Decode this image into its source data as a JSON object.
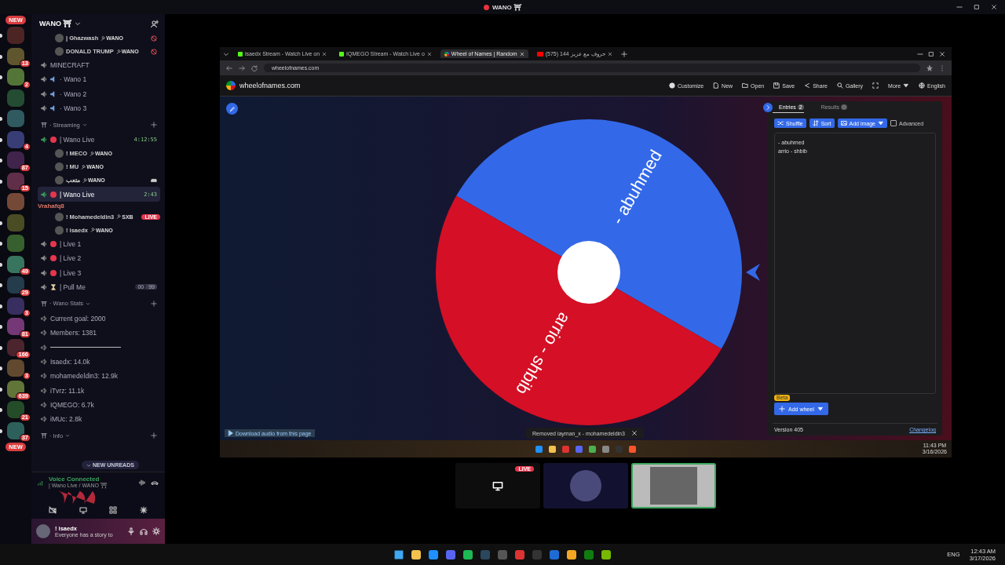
{
  "titlebar": {
    "title": "WANO ⛩"
  },
  "servers": {
    "new_top": "NEW",
    "new_bottom": "NEW",
    "items": [
      {
        "unread": true
      },
      {
        "unread": true,
        "badge": "13"
      },
      {
        "unread": true,
        "badge": "2"
      },
      {
        "unread": false
      },
      {
        "unread": true
      },
      {
        "unread": true,
        "badge": "4"
      },
      {
        "unread": true,
        "badge": "87"
      },
      {
        "unread": true,
        "badge": "15"
      },
      {
        "unread": false
      },
      {
        "unread": true
      },
      {
        "unread": true
      },
      {
        "unread": true,
        "badge": "49"
      },
      {
        "unread": true,
        "badge": "29"
      },
      {
        "unread": true,
        "badge": "3"
      },
      {
        "unread": true,
        "badge": "81"
      },
      {
        "unread": true,
        "badge": "166"
      },
      {
        "unread": true,
        "badge": "3"
      },
      {
        "unread": true,
        "badge": "639"
      },
      {
        "unread": true,
        "badge": "21"
      },
      {
        "unread": true,
        "badge": "37"
      }
    ]
  },
  "sidebar": {
    "server_name": "WANO ⛩",
    "items": [
      {
        "kind": "member",
        "name": "| Ghazwash",
        "tag": "WANO",
        "muted": true,
        "playing": false
      },
      {
        "kind": "member",
        "name": "DONALD TRUMP",
        "tag": "WANO",
        "muted": true,
        "playing": false
      },
      {
        "kind": "plain",
        "name": "MINECRAFT",
        "connected": false,
        "selected": false
      },
      {
        "kind": "audio",
        "name": "· Wano 1",
        "connected": false,
        "selected": false
      },
      {
        "kind": "audio",
        "name": "· Wano 2",
        "connected": false,
        "selected": false
      },
      {
        "kind": "audio",
        "name": "· Wano 3",
        "connected": false,
        "selected": false
      },
      {
        "kind": "category",
        "name": "· Streaming",
        "expanded": true
      },
      {
        "kind": "live",
        "name": "| Wano Live",
        "connected": true,
        "selected": false,
        "duration": "4:12:55",
        "children": [
          {
            "kind": "member",
            "name": "! MECO",
            "tag": "WANO",
            "muted": false,
            "playing": false
          },
          {
            "kind": "member",
            "name": "! MU",
            "tag": "WANO",
            "muted": false,
            "playing": false
          },
          {
            "kind": "member",
            "name": "متعب",
            "tag": "WANO",
            "muted": false,
            "playing": true
          }
        ]
      },
      {
        "kind": "live",
        "name": "| Wano Live",
        "connected": true,
        "selected": true,
        "duration": "2:43",
        "overlay": "Vrahafq8",
        "children": [
          {
            "kind": "member",
            "name": "! Mohamedeldin3",
            "tag": "SXB",
            "badge": "LIVE",
            "muted": false,
            "playing": false
          },
          {
            "kind": "member",
            "name": "! isaedx",
            "tag": "WANO",
            "muted": false,
            "playing": false
          }
        ]
      },
      {
        "kind": "live",
        "name": "| Live 1",
        "connected": false,
        "selected": false
      },
      {
        "kind": "live",
        "name": "| Live 2",
        "connected": false,
        "selected": false
      },
      {
        "kind": "live",
        "name": "| Live 3",
        "connected": false,
        "selected": false
      },
      {
        "kind": "timer",
        "name": "| Pull Me",
        "connected": false,
        "selected": false,
        "users": "00",
        "limit": "99"
      },
      {
        "kind": "category",
        "name": "· Wano Stats",
        "expanded": true
      },
      {
        "kind": "stat",
        "name": "Current goal: 2000"
      },
      {
        "kind": "stat",
        "name": "Members: 1381"
      },
      {
        "kind": "rule"
      },
      {
        "kind": "stat",
        "name": "Isaedx: 14.0k"
      },
      {
        "kind": "stat",
        "name": "mohamedeldin3: 12.9k"
      },
      {
        "kind": "stat",
        "name": "iTvrz: 11.1k"
      },
      {
        "kind": "stat",
        "name": "IQMEGO: 6.7k"
      },
      {
        "kind": "stat",
        "name": "iMUc: 2.8k"
      },
      {
        "kind": "category",
        "name": "· Info",
        "expanded": true
      }
    ],
    "unreads_pill": "NEW UNREADS"
  },
  "voice": {
    "status": "Voice Connected",
    "channel": "| Wano Live / WANO ⛩"
  },
  "user": {
    "name": "! isaedx",
    "status": "Everyone has a story to"
  },
  "browser": {
    "tabs": [
      {
        "title": "isaedx Stream - Watch Live on",
        "selected": false,
        "kind": "kick"
      },
      {
        "title": "IQMEGO Stream - Watch Live o",
        "selected": false,
        "kind": "kick"
      },
      {
        "title": "Wheel of Names | Random",
        "selected": true,
        "kind": "wheel"
      },
      {
        "title": "(575) حروف مع عزيز 144",
        "selected": false,
        "kind": "video"
      }
    ],
    "url": "wheelofnames.com",
    "site_name": "wheelofnames.com",
    "nav": [
      {
        "kind": "customize",
        "label": "Customize"
      },
      {
        "kind": "new",
        "label": "New"
      },
      {
        "kind": "open",
        "label": "Open"
      },
      {
        "kind": "save",
        "label": "Save"
      },
      {
        "kind": "share",
        "label": "Share"
      },
      {
        "kind": "gallery",
        "label": "Gallery"
      },
      {
        "kind": "fullscreen"
      },
      {
        "kind": "more",
        "label": "More"
      },
      {
        "kind": "language",
        "label": "English"
      }
    ],
    "wheel": {
      "segments": [
        {
          "label": "- abuhmed",
          "color": "#3369e8"
        },
        {
          "label": "arrio - shbib",
          "color": "#d50f25"
        }
      ]
    },
    "panel": {
      "tabs": [
        {
          "label": "Entries",
          "count": "2",
          "selected": true
        },
        {
          "label": "Results",
          "count": "0",
          "selected": false
        }
      ],
      "tools": [
        {
          "kind": "shuffle",
          "label": "Shuffle"
        },
        {
          "kind": "sort",
          "label": "Sort"
        },
        {
          "kind": "image",
          "label": "Add image"
        }
      ],
      "advanced": {
        "label": "Advanced",
        "checked": false
      },
      "entries": [
        "- abuhmed",
        "arrio - shbib"
      ],
      "add_wheel": "Add wheel",
      "beta": "Beta",
      "version": "Version 405",
      "changelog": "Changelog"
    },
    "download_bar": "Download audio from this page",
    "toast": "Removed iayman_x - mohamedeldin3",
    "inner_time": "11:43 PM",
    "inner_date": "3/16/2026"
  },
  "tiles": [
    {
      "kind": "screen",
      "badge": "LIVE",
      "speaking": false
    },
    {
      "kind": "avatar",
      "speaking": false
    },
    {
      "kind": "video",
      "speaking": true
    }
  ],
  "taskbar": {
    "lang": "ENG",
    "time": "12:43 AM",
    "date": "3/17/2026"
  }
}
